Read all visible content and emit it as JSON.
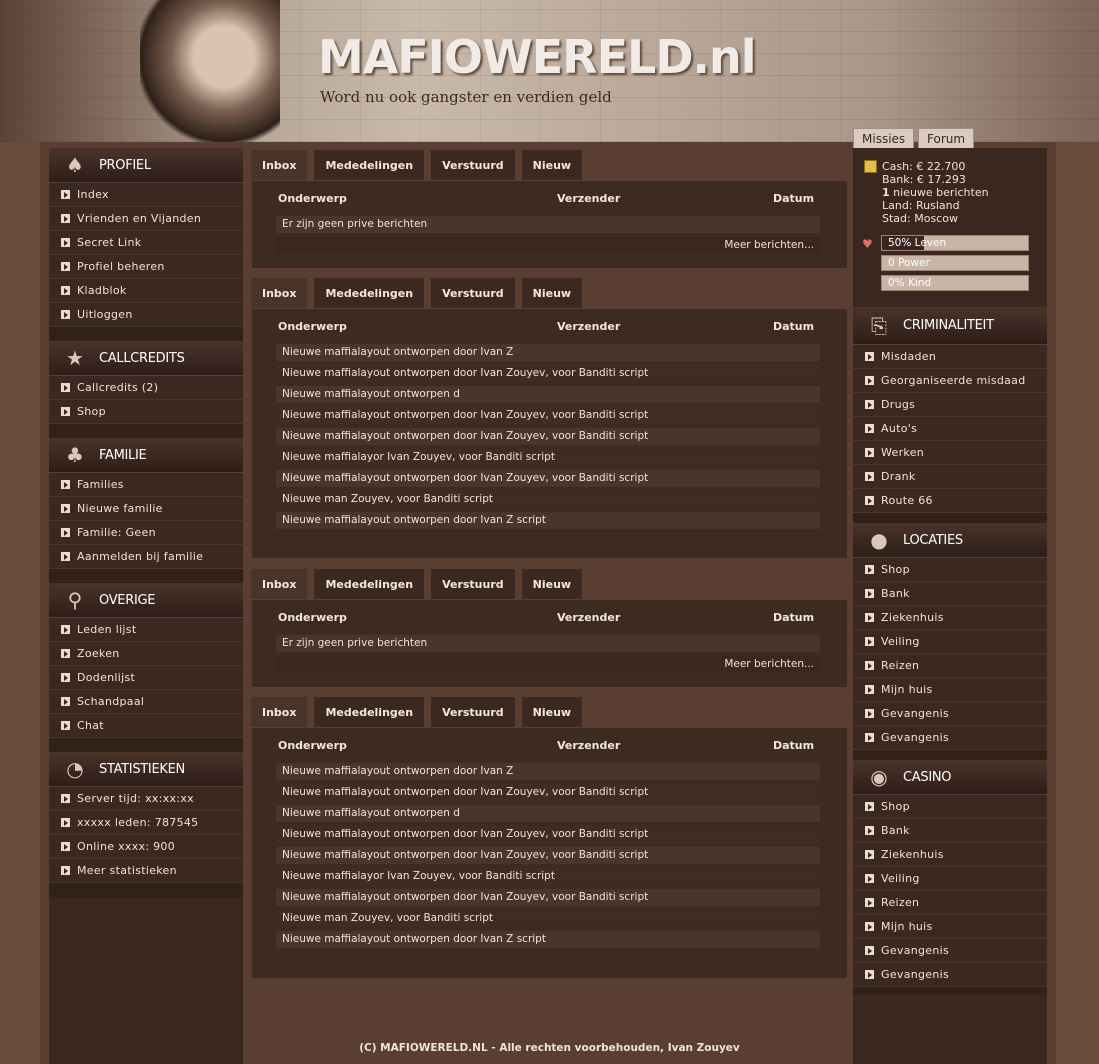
{
  "header": {
    "logo": "MAFIOWERELD.nl",
    "slogan": "Word nu ook gangster en verdien geld"
  },
  "toptabs": [
    "Missies",
    "Forum"
  ],
  "left": {
    "profiel": {
      "title": "PROFIEL",
      "items": [
        "Index",
        "Vrienden en Vijanden",
        "Secret Link",
        "Profiel beheren",
        "Kladblok",
        "Uitloggen"
      ]
    },
    "callcredits": {
      "title": "CALLCREDITS",
      "items": [
        "Callcredits (2)",
        "Shop"
      ]
    },
    "familie": {
      "title": "FAMILIE",
      "items": [
        "Families",
        "Nieuwe familie",
        "Familie: Geen",
        "Aanmelden bij familie"
      ]
    },
    "overige": {
      "title": "OVERIGE",
      "items": [
        "Leden lijst",
        "Zoeken",
        "Dodenlijst",
        "Schandpaal",
        "Chat"
      ]
    },
    "statistieken": {
      "title": "STATISTIEKEN",
      "items": [
        "Server tijd: xx:xx:xx",
        "xxxxx leden: 787545",
        "Online xxxx: 900",
        "Meer statistieken"
      ]
    }
  },
  "tabs": [
    "Inbox",
    "Mededelingen",
    "Verstuurd",
    "Nieuw"
  ],
  "columns": {
    "subject": "Onderwerp",
    "sender": "Verzender",
    "date": "Datum"
  },
  "empty_message": "Er zijn geen prive berichten",
  "more_link": "Meer berichten...",
  "messages": [
    "Nieuwe maffialayout ontworpen door Ivan Z",
    "Nieuwe maffialayout ontworpen door Ivan Zouyev, voor Banditi script",
    "Nieuwe maffialayout ontworpen d",
    "Nieuwe maffialayout ontworpen door Ivan Zouyev, voor Banditi script",
    "Nieuwe maffialayout ontworpen door Ivan Zouyev, voor Banditi script",
    "Nieuwe maffialayor Ivan Zouyev, voor Banditi script",
    "Nieuwe maffialayout ontworpen door Ivan Zouyev, voor Banditi script",
    "Nieuwe man Zouyev, voor Banditi script",
    "Nieuwe maffialayout ontworpen door Ivan Z script"
  ],
  "stats": {
    "cash": "Cash: € 22.700",
    "bank": "Bank: € 17.293",
    "new_count": "1",
    "new_text": " nieuwe berichten",
    "land": "Land: Rusland",
    "stad": "Stad: Moscow"
  },
  "bars": [
    {
      "label": "50% Leven",
      "fraction": 0.5
    },
    {
      "label": "0 Power",
      "fraction": 0.0
    },
    {
      "label": "0% Kind",
      "fraction": 0.0
    }
  ],
  "right": {
    "criminaliteit": {
      "title": "CRIMINALITEIT",
      "items": [
        "Misdaden",
        "Georganiseerde misdaad",
        "Drugs",
        "Auto's",
        "Werken",
        "Drank",
        "Route 66"
      ]
    },
    "locaties": {
      "title": "LOCATIES",
      "items": [
        "Shop",
        "Bank",
        "Ziekenhuis",
        "Veiling",
        "Reizen",
        "Mijn huis",
        "Gevangenis",
        "Gevangenis"
      ]
    },
    "casino": {
      "title": "CASINO",
      "items": [
        "Shop",
        "Bank",
        "Ziekenhuis",
        "Veiling",
        "Reizen",
        "Mijn huis",
        "Gevangenis",
        "Gevangenis"
      ]
    }
  },
  "footer": "(C) MAFIOWERELD.NL - Alle rechten voorbehouden, Ivan Zouyev"
}
